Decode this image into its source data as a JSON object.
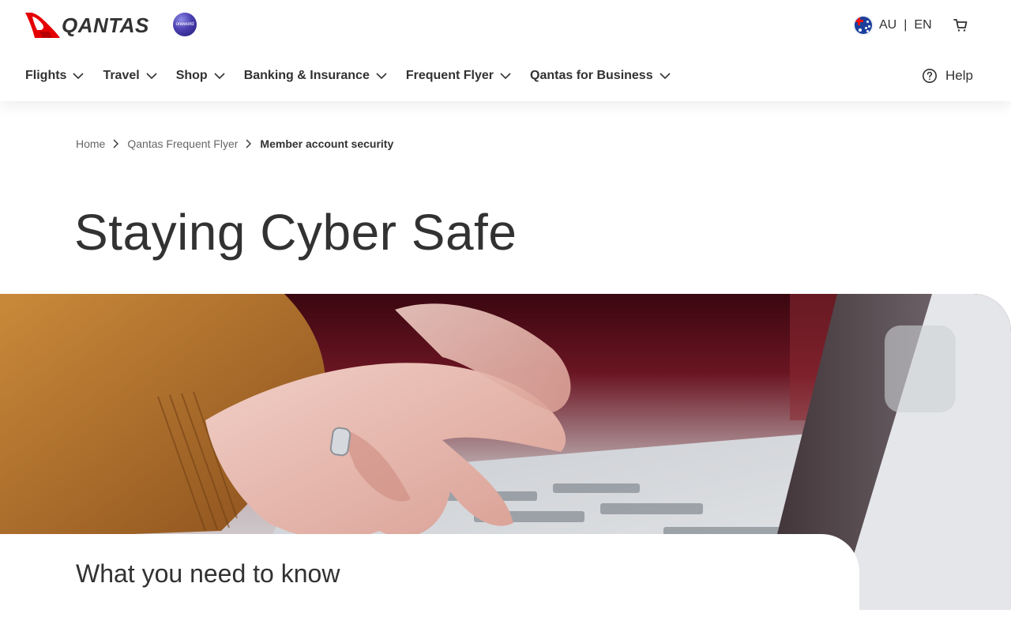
{
  "brand": {
    "name": "QANTAS",
    "partner": "oneworld",
    "logo_icon": "kangaroo-logo-icon"
  },
  "locale": {
    "country": "AU",
    "separator": "|",
    "language": "EN",
    "flag_icon": "australia-flag-icon"
  },
  "cart": {
    "icon": "cart-icon"
  },
  "nav": {
    "items": [
      {
        "label": "Flights"
      },
      {
        "label": "Travel"
      },
      {
        "label": "Shop"
      },
      {
        "label": "Banking & Insurance"
      },
      {
        "label": "Frequent Flyer"
      },
      {
        "label": "Qantas for Business"
      }
    ],
    "help_label": "Help"
  },
  "breadcrumb": {
    "items": [
      "Home",
      "Qantas Frequent Flyer"
    ],
    "current": "Member account security"
  },
  "page": {
    "title": "Staying Cyber Safe",
    "hero_image": "hands-typing-on-laptop",
    "section_heading": "What you need to know"
  },
  "colors": {
    "brand_red": "#e40000",
    "text": "#323232",
    "muted": "#666666"
  }
}
